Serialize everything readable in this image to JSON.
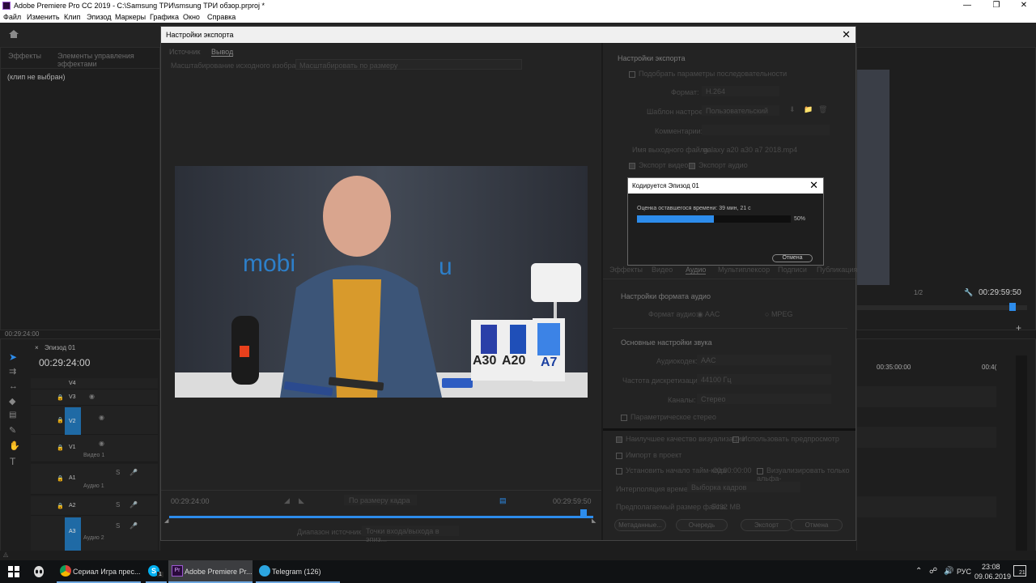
{
  "window": {
    "title": "Adobe Premiere Pro CC 2019 - C:\\Samsung ТРИ\\smsung ТРИ обзор.prproj *"
  },
  "menu": [
    "Файл",
    "Изменить",
    "Клип",
    "Эпизод",
    "Маркеры",
    "Графика",
    "Окно",
    "Справка"
  ],
  "left_panel": {
    "tab_effects": "Эффекты",
    "tab_controls": "Элементы управления эффектами",
    "no_clip": "(клип не выбран)",
    "timecode": "00:29:24:00"
  },
  "timeline": {
    "tab": "Эпизод 01",
    "timecode": "00:29:24:00",
    "tracks": [
      {
        "name": "V4"
      },
      {
        "name": "V3"
      },
      {
        "name": "V2"
      },
      {
        "name": "V1",
        "sub": "Видео 1"
      },
      {
        "name": "A1",
        "sub": "Аудио 1"
      },
      {
        "name": "A2"
      },
      {
        "name": "A3",
        "sub": "Аудио 2"
      }
    ],
    "ruler_time1": "00:35:00:00",
    "ruler_time2": "00:4("
  },
  "program_monitor": {
    "timecode": "00:29:59:50",
    "zoom": "1/2"
  },
  "export_dialog": {
    "title": "Настройки экспорта",
    "tab_source": "Источник",
    "tab_output": "Вывод",
    "scaling_label": "Масштабирование исходного изображения:",
    "scaling_value": "Масштабировать по размеру",
    "video_words": {
      "brand": "mobi",
      "brand_tail": "u",
      "box1": "A30",
      "box2": "A20",
      "box3": "A7"
    },
    "time_in": "00:29:24:00",
    "time_out": "00:29:59:50",
    "fit": "По размеру кадра",
    "range_label": "Диапазон источника:",
    "range_value": "Точки входа/выхода в эпиз...",
    "settings_header": "Настройки экспорта",
    "match_sequence": "Подобрать параметры последовательности",
    "format_label": "Формат:",
    "format_value": "H.264",
    "preset_label": "Шаблон настроек:",
    "preset_value": "Пользовательский",
    "comments_label": "Комментарии:",
    "output_name_label": "Имя выходного файла:",
    "output_name_value": "galaxy a20 a30 a7 2018.mp4",
    "export_video": "Экспорт видео",
    "export_audio": "Экспорт аудио",
    "tabs": [
      "Эффекты",
      "Видео",
      "Аудио",
      "Мультиплексор",
      "Подписи",
      "Публикация"
    ],
    "audio_format_header": "Настройки формата аудио",
    "audio_format_label": "Формат аудио:",
    "audio_format_aac": "AAC",
    "audio_format_mpeg": "MPEG",
    "basic_audio_header": "Основные настройки звука",
    "codec_label": "Аудиокодек:",
    "codec_value": "AAC",
    "sample_rate_label": "Частота дискретизации:",
    "sample_rate_value": "44100 Гц",
    "channels_label": "Каналы:",
    "channels_value": "Стерео",
    "param_stereo": "Параметрическое стерео",
    "max_quality": "Наилучшее качество визуализации",
    "use_preview": "Использовать предпросмотр",
    "import_project": "Импорт в проект",
    "set_start_tc": "Установить начало тайм-кода",
    "start_tc_value": "00:00:00:00",
    "render_alpha": "Визуализировать только альфа-",
    "time_interp_label": "Интерполяция времени:",
    "time_interp_value": "Выборка кадров",
    "file_size_label": "Предполагаемый размер файла:",
    "file_size_value": "5432 MB",
    "btn_metadata": "Метаданные...",
    "btn_queue": "Очередь",
    "btn_export": "Экспорт",
    "btn_cancel": "Отмена"
  },
  "encoding_dialog": {
    "title": "Кодируется Эпизод 01",
    "remaining": "Оценка оставшегося времени: 39 мин, 21 с",
    "progress": 0.5,
    "percent": "50%",
    "cancel": "Отмена"
  },
  "taskbar": {
    "items": [
      {
        "label": "Сериал Игра прес..."
      },
      {
        "label": "Adobe Premiere Pr..."
      },
      {
        "label": "Telegram (126)"
      }
    ],
    "skype_badge": "1",
    "lang": "РУС",
    "time": "23:08",
    "date": "09.06.2019",
    "notif_count": "21"
  },
  "colors": {
    "accent_blue": "#2d8ceb",
    "progress_blue": "#2d8ceb",
    "track_blue": "#1f6aa5"
  }
}
